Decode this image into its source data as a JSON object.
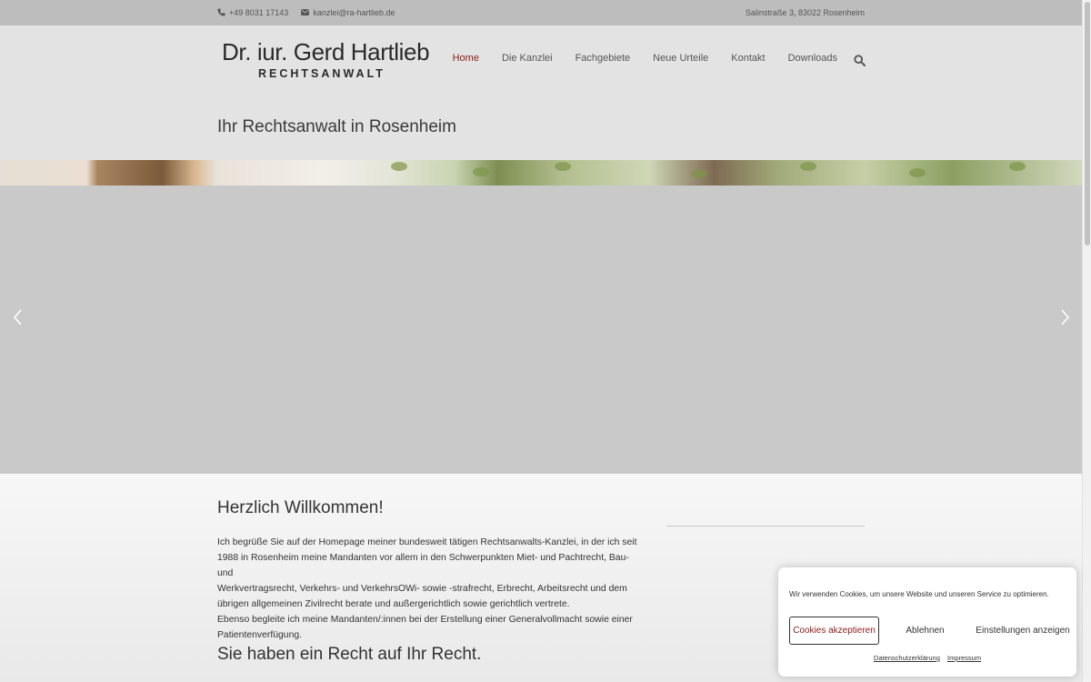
{
  "topbar": {
    "phone": "+49 8031 17143",
    "email": "kanzlei@ra-hartlieb.de",
    "address": "Salinstraße 3, 83022 Rosenheim",
    "phone_icon": "phone-icon",
    "email_icon": "envelope-icon"
  },
  "logo": {
    "name": "Dr. iur. Gerd Hartlieb",
    "subtitle": "RECHTSANWALT"
  },
  "nav": {
    "items": [
      {
        "label": "Home",
        "active": true
      },
      {
        "label": "Die Kanzlei",
        "active": false
      },
      {
        "label": "Fachgebiete",
        "active": false
      },
      {
        "label": "Neue Urteile",
        "active": false
      },
      {
        "label": "Kontakt",
        "active": false
      },
      {
        "label": "Downloads",
        "active": false
      }
    ],
    "search_icon": "search-icon",
    "active_color": "#8b1a1a"
  },
  "tagline": "Ihr Rechtsanwalt in Rosenheim",
  "slider": {
    "prev_icon": "chevron-left-icon",
    "next_icon": "chevron-right-icon"
  },
  "content": {
    "welcome_heading": "Herzlich Willkommen!",
    "intro_lines": [
      "Ich begrüße Sie auf der Homepage meiner bundesweit tätigen Rechtsanwalts-Kanzlei, in der ich seit",
      "1988 in Rosenheim meine Mandanten vor allem in den Schwerpunkten Miet- und Pachtrecht, Bau- und",
      "Werkvertragsrecht, Verkehrs- und VerkehrsOWi- sowie -strafrecht, Erbrecht, Arbeitsrecht und dem",
      "übrigen allgemeinen Zivilrecht berate und außergerichtlich sowie gerichtlich vertrete.",
      "Ebenso begleite ich meine Mandanten/:innen bei der Erstellung einer Generalvollmacht sowie einer",
      "Patientenverfügung."
    ],
    "sub_heading": "Sie haben ein Recht auf Ihr Recht."
  },
  "cookie": {
    "message": "Wir verwenden Cookies, um unsere Website und unseren Service zu optimieren.",
    "accept": "Cookies akzeptieren",
    "decline": "Ablehnen",
    "settings": "Einstellungen anzeigen",
    "privacy": "Datenschutzerklärung",
    "imprint": "Impressum"
  }
}
